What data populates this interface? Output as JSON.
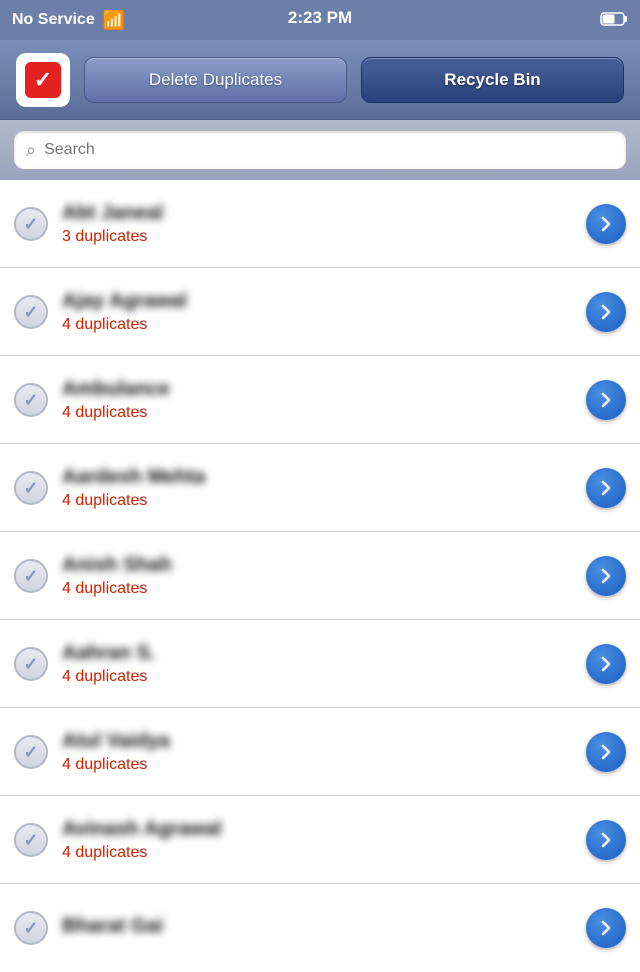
{
  "statusBar": {
    "signal": "No Service",
    "time": "2:23 PM",
    "battery": "🔋"
  },
  "toolbar": {
    "deleteDuplicates": "Delete Duplicates",
    "recycleBin": "Recycle Bin"
  },
  "search": {
    "placeholder": "Search"
  },
  "contacts": [
    {
      "name": "Abt Janeal",
      "duplicates": "3 duplicates"
    },
    {
      "name": "Ajay Agrawal",
      "duplicates": "4 duplicates"
    },
    {
      "name": "Ambulance",
      "duplicates": "4 duplicates"
    },
    {
      "name": "Aardesh Mehta",
      "duplicates": "4 duplicates"
    },
    {
      "name": "Anish Shah",
      "duplicates": "4 duplicates"
    },
    {
      "name": "Aahran S.",
      "duplicates": "4 duplicates"
    },
    {
      "name": "Atul Vaidya",
      "duplicates": "4 duplicates"
    },
    {
      "name": "Avinash Agrawal",
      "duplicates": "4 duplicates"
    },
    {
      "name": "Bharat Gai",
      "duplicates": ""
    }
  ],
  "colors": {
    "accent": "#1a5abf",
    "duplicate": "#cc2200",
    "headerBg": "#6b7fa8"
  }
}
